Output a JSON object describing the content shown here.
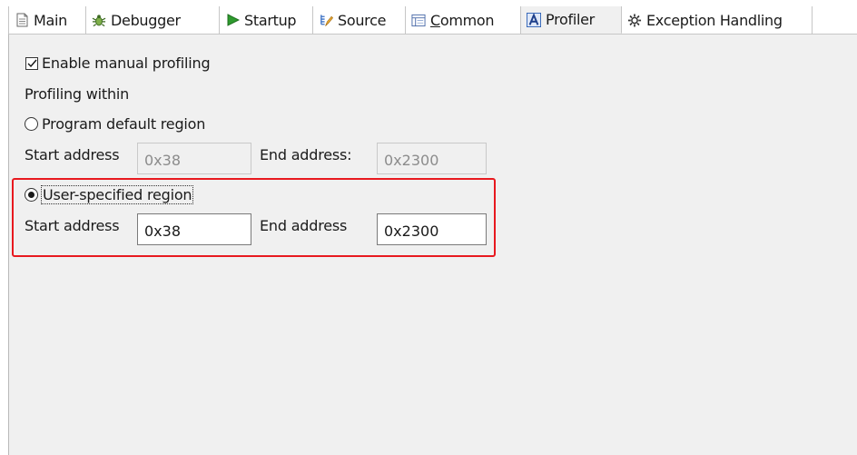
{
  "tabs": [
    {
      "label": "Main",
      "icon": "document-icon",
      "underline": ""
    },
    {
      "label": "Debugger",
      "icon": "bug-icon",
      "underline": ""
    },
    {
      "label": "Startup",
      "icon": "play-icon",
      "underline": ""
    },
    {
      "label": "Source",
      "icon": "source-icon",
      "underline": ""
    },
    {
      "label": "Common",
      "icon": "common-icon",
      "underline": "C"
    },
    {
      "label": "Profiler",
      "icon": "profiler-icon",
      "underline": ""
    },
    {
      "label": "Exception Handling",
      "icon": "exception-gear-icon",
      "underline": ""
    }
  ],
  "active_tab": "Profiler",
  "profiler": {
    "enable_label": "Enable manual profiling",
    "enable_checked": true,
    "within_label": "Profiling within",
    "default_region": {
      "label": "Program default region",
      "selected": false,
      "start_label": "Start address",
      "start_value": "0x38",
      "end_label": "End address:",
      "end_value": "0x2300"
    },
    "user_region": {
      "label": "User-specified region",
      "selected": true,
      "start_label": "Start address",
      "start_value": "0x38",
      "end_label": "End address",
      "end_value": "0x2300"
    }
  },
  "colors": {
    "panel_bg": "#f0f0f0",
    "highlight_border": "#e8191f",
    "profiler_icon": "#2b5fb4",
    "startup_icon": "#2e9a2e"
  }
}
